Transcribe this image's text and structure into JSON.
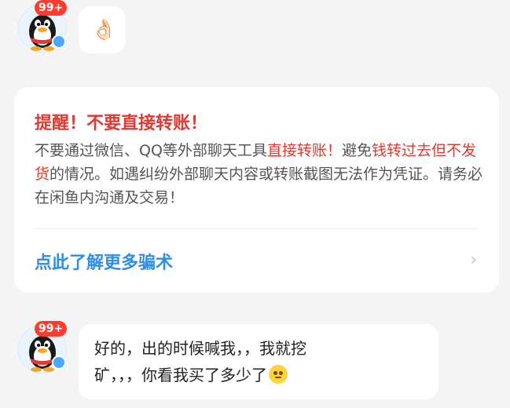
{
  "messages": [
    {
      "avatar": {
        "badge": "99+"
      },
      "emoji": "👌🏻"
    },
    {
      "avatar": {
        "badge": "99+"
      },
      "text_line1": "好的，出的时候喊我，，我就挖",
      "text_line2": "矿，，，你看我买了多少了"
    }
  ],
  "warning_card": {
    "title": "提醒！不要直接转账！",
    "body_part1": "不要通过微信、QQ等外部聊天工具",
    "body_hl1": "直接转账！",
    "body_part2": "避免",
    "body_hl2": "钱转过去但不发货",
    "body_part3": "的情况。如遇纠纷外部聊天内容或转账截图无法作为凭证。请务必在闲鱼内沟通及交易！",
    "link_text": "点此了解更多骗术",
    "chevron": "›"
  },
  "colors": {
    "warning_red": "#e3382f",
    "link_blue": "#2e8ee6",
    "background": "#f4f4f4"
  }
}
